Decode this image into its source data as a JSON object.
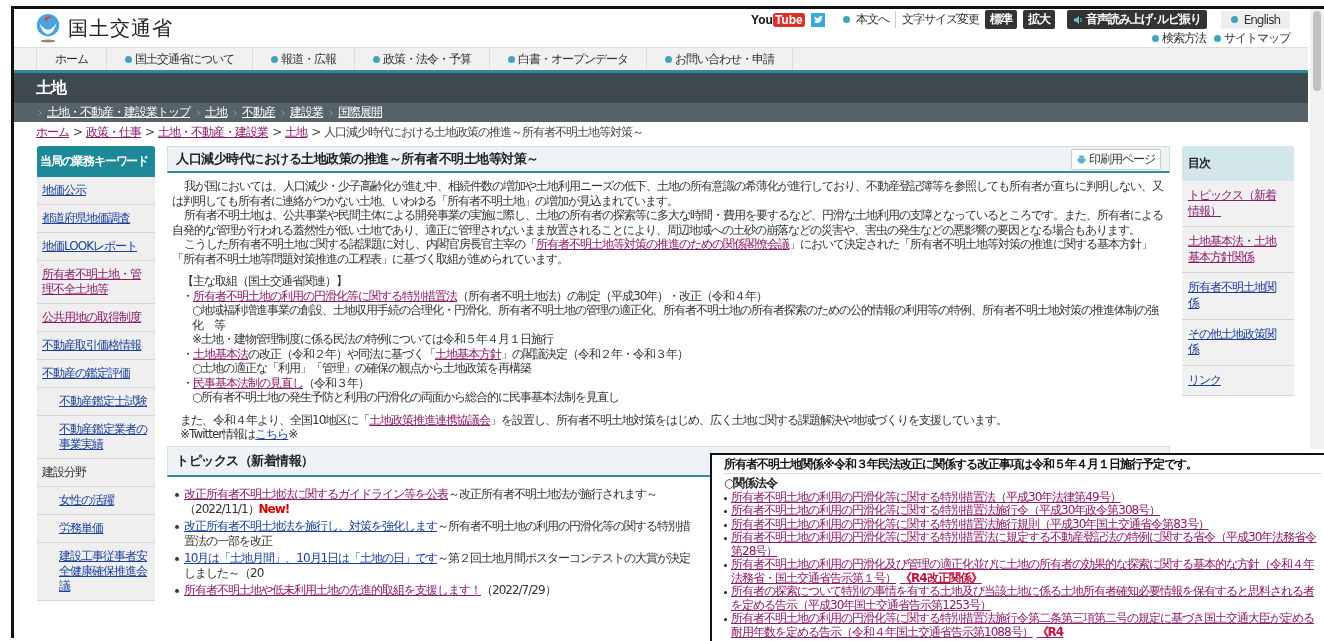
{
  "header": {
    "logo": "国土交通省",
    "youtube": [
      "You",
      "Tube"
    ],
    "tools": [
      {
        "kind": "link",
        "label": "本文へ"
      },
      {
        "kind": "label",
        "label": "文字サイズ変更"
      },
      {
        "kind": "size",
        "label": "標準"
      },
      {
        "kind": "size",
        "label": "拡大"
      },
      {
        "kind": "voice",
        "label": "音声読み上げ･ルビ振り"
      },
      {
        "kind": "lang",
        "label": "English"
      }
    ],
    "sublinks": [
      "検索方法",
      "サイトマップ"
    ]
  },
  "nav": [
    {
      "label": "ホーム",
      "dot": false
    },
    {
      "label": "国土交通省について",
      "dot": true
    },
    {
      "label": "報道・広報",
      "dot": true
    },
    {
      "label": "政策・法令・予算",
      "dot": true
    },
    {
      "label": "白書・オープンデータ",
      "dot": true
    },
    {
      "label": "お問い合わせ・申請",
      "dot": true
    }
  ],
  "section_title": "土地",
  "subnav": [
    "土地・不動産・建設業トップ",
    "土地",
    "不動産",
    "建設業",
    "国際展開"
  ],
  "breadcrumb": {
    "separator": ">",
    "items": [
      {
        "label": "ホーム",
        "kind": "link"
      },
      {
        "label": "政策・仕事",
        "kind": "link"
      },
      {
        "label": "土地・不動産・建設業",
        "kind": "link"
      },
      {
        "label": "土地",
        "kind": "link"
      },
      {
        "label": "人口減少時代における土地政策の推進～所有者不明土地等対策～",
        "kind": "current"
      }
    ]
  },
  "sidebar": {
    "title": "当局の業務キーワード",
    "items": [
      {
        "label": "地価公示",
        "kind": "link",
        "visited": false
      },
      {
        "label": "都道府県地価調査",
        "kind": "link",
        "visited": false
      },
      {
        "label": "地価LOOKレポート",
        "kind": "link",
        "visited": false
      },
      {
        "label": "所有者不明土地・管理不全土地等",
        "kind": "link",
        "visited": true
      },
      {
        "label": "公共用地の取得制度",
        "kind": "link",
        "visited": true
      },
      {
        "label": "不動産取引価格情報",
        "kind": "link",
        "visited": false
      },
      {
        "label": "不動産の鑑定評価",
        "kind": "link",
        "visited": false,
        "children": [
          {
            "label": "不動産鑑定士試験",
            "kind": "link",
            "visited": false
          },
          {
            "label": "不動産鑑定業者の事業実績",
            "kind": "link",
            "visited": false
          }
        ]
      },
      {
        "label": "建設分野",
        "kind": "heading",
        "children": [
          {
            "label": "女性の活躍",
            "kind": "link",
            "visited": false
          },
          {
            "label": "労務単価",
            "kind": "link",
            "visited": false
          },
          {
            "label": "建設工事従事者安全健康確保推進会議",
            "kind": "link",
            "visited": false
          }
        ]
      }
    ]
  },
  "article": {
    "title": "人口減少時代における土地政策の推進～所有者不明土地等対策～",
    "print_button": "印刷用ページ",
    "paragraphs": [
      [
        {
          "kind": "text",
          "text": "我が国においては、人口減少・少子高齢化が進む中、相続件数の増加や土地利用ニーズの低下、土地の所有意識の希薄化が進行しており、不動産登記簿等を参照しても所有者が直ちに判明しない、又は判明しても所有者に連絡がつかない土地、いわゆる「所有者不明土地」の増加が見込まれています。"
        }
      ],
      [
        {
          "kind": "text",
          "text": "所有者不明土地は、公共事業や民間主体による開発事業の実施に際し、土地の所有者の探索等に多大な時間・費用を要するなど、円滑な土地利用の支障となっているところです。また、所有者による自発的な管理が行われる蓋然性が低い土地であり、適正に管理されないまま放置されることにより、周辺地域への土砂の崩落などの災害や、害虫の発生などの悪影響の要因となる場合もあります。"
        }
      ],
      [
        {
          "kind": "text",
          "text": "こうした所有者不明土地に関する諸課題に対し、内閣官房長官主宰の「"
        },
        {
          "kind": "link",
          "text": "所有者不明土地等対策の推進のための関係閣僚会議",
          "visited": true
        },
        {
          "kind": "text",
          "text": "」において決定された「所有者不明土地等対策の推進に関する基本方針」「所有者不明土地等問題対策推進の工程表」に基づく取組が進められています。"
        }
      ]
    ],
    "efforts_heading": "【主な取組（国土交通省関連）】",
    "efforts": [
      {
        "kind": "bullet",
        "parts": [
          {
            "kind": "text",
            "text": "・"
          },
          {
            "kind": "link",
            "text": "所有者不明土地の利用の円滑化等に関する特別措置法",
            "visited": true
          },
          {
            "kind": "text",
            "text": "（所有者不明土地法）の制定（平成30年）・改正（令和４年）"
          }
        ]
      },
      {
        "kind": "sub",
        "parts": [
          {
            "kind": "text",
            "text": "○地域福利増進事業の創設、土地収用手続の合理化・円滑化、所有者不明土地の管理の適正化、所有者不明土地の所有者探索のための公的情報の利用等の特例、所有者不明土地対策の推進体制の強化　等"
          }
        ]
      },
      {
        "kind": "sub",
        "parts": [
          {
            "kind": "text",
            "text": "※土地・建物管理制度に係る民法の特例については令和５年４月１日施行"
          }
        ]
      },
      {
        "kind": "bullet",
        "parts": [
          {
            "kind": "text",
            "text": "・"
          },
          {
            "kind": "link",
            "text": "土地基本法",
            "visited": true
          },
          {
            "kind": "text",
            "text": "の改正（令和２年）や同法に基づく「"
          },
          {
            "kind": "link",
            "text": "土地基本方針",
            "visited": true
          },
          {
            "kind": "text",
            "text": "」の閣議決定（令和２年・令和３年）"
          }
        ]
      },
      {
        "kind": "sub",
        "parts": [
          {
            "kind": "text",
            "text": "○土地の適正な「利用」「管理」の確保の観点から土地政策を再構築"
          }
        ]
      },
      {
        "kind": "bullet",
        "parts": [
          {
            "kind": "text",
            "text": "・"
          },
          {
            "kind": "link",
            "text": "民事基本法制の見直し",
            "visited": true
          },
          {
            "kind": "text",
            "text": "（令和３年）"
          }
        ]
      },
      {
        "kind": "sub",
        "parts": [
          {
            "kind": "text",
            "text": "○所有者不明土地の発生予防と利用の円滑化の両面から総合的に民事基本法制を見直し"
          }
        ]
      }
    ],
    "closing": [
      [
        {
          "kind": "text",
          "text": "また、令和４年より、全国10地区に「"
        },
        {
          "kind": "link",
          "text": "土地政策推進連携協議会",
          "visited": true
        },
        {
          "kind": "text",
          "text": "」を設置し、所有者不明土地対策をはじめ、広く土地に関する課題解決や地域づくりを支援しています。"
        }
      ],
      [
        {
          "kind": "text",
          "text": "※Twitter情報は"
        },
        {
          "kind": "link",
          "text": "こちら",
          "visited": false
        },
        {
          "kind": "text",
          "text": "※"
        }
      ]
    ]
  },
  "topics": {
    "title": "トピックス（新着情報）",
    "items": [
      [
        {
          "kind": "link",
          "text": "改正所有者不明土地法に関するガイドライン等を公表",
          "visited": true
        },
        {
          "kind": "text",
          "text": "～改正所有者不明土地法が施行されます～（2022/11/1）"
        },
        {
          "kind": "new",
          "text": "New!"
        }
      ],
      [
        {
          "kind": "link",
          "text": "改正所有者不明土地法を施行し、対策を強化します",
          "visited": false
        },
        {
          "kind": "text",
          "text": "～所有者不明土地の利用の円滑化等の関する特別措置法の一部を改正"
        }
      ],
      [
        {
          "kind": "link",
          "text": "10月は「土地月間」、10月1日は「土地の日」です",
          "visited": false
        },
        {
          "kind": "text",
          "text": "～第２回土地月間ポスターコンテストの大賞が決定しました～（20"
        }
      ],
      [
        {
          "kind": "link",
          "text": "所有者不明土地や低未利用土地の先進的取組を支援します！",
          "visited": true
        },
        {
          "kind": "text",
          "text": "（2022/7/29）"
        }
      ]
    ]
  },
  "toc": {
    "title": "目次",
    "items": [
      {
        "label": "トピックス（新着情報）",
        "visited": true
      },
      {
        "label": "土地基本法・土地基本方針関係",
        "visited": true
      },
      {
        "label": "所有者不明土地関係",
        "visited": false
      },
      {
        "label": "その他土地政策関係",
        "visited": false
      },
      {
        "label": "リンク",
        "visited": false
      }
    ]
  },
  "inset": {
    "title": "所有者不明土地関係※令和３年民法改正に関係する改正事項は令和５年４月１日施行予定です。",
    "section": "○関係法令",
    "items": [
      {
        "kind": "bullet",
        "parts": [
          {
            "kind": "link",
            "text": "所有者不明土地の利用の円滑化等に関する特別措置法（平成30年法律第49号）",
            "visited": true
          }
        ]
      },
      {
        "kind": "bullet",
        "parts": [
          {
            "kind": "link",
            "text": "所有者不明土地の利用の円滑化等に関する特別措置法施行令（平成30年政令第308号）",
            "visited": true
          }
        ]
      },
      {
        "kind": "bullet",
        "parts": [
          {
            "kind": "link",
            "text": "所有者不明土地の利用の円滑化等に関する特別措置法施行規則（平成30年国土交通省令第83号）",
            "visited": true
          }
        ]
      },
      {
        "kind": "bullet",
        "parts": [
          {
            "kind": "link",
            "text": "所有者不明土地の利用の円滑化等に関する特別措置法に規定する不動産登記法の特例に関する省令（平成30年法務省令第28号）",
            "visited": true
          }
        ]
      },
      {
        "kind": "bullet",
        "parts": [
          {
            "kind": "link",
            "text": "所有者不明土地の利用の円滑化及び管理の適正化並びに土地の所有者の効果的な探索に関する基本的な方針（令和４年法務省・国土交通省告示第１号）",
            "visited": true
          },
          {
            "kind": "tag",
            "text": "《R4改正関係》"
          }
        ]
      },
      {
        "kind": "bullet",
        "parts": [
          {
            "kind": "link",
            "text": "所有者の探索について特別の事情を有する土地及び当該土地に係る土地所有者確知必要情報を保有すると思料される者を定める告示（平成30年国土交通省告示第1253号）",
            "visited": true
          }
        ]
      },
      {
        "kind": "bullet",
        "parts": [
          {
            "kind": "link",
            "text": "所有者不明土地の利用の円滑化等に関する特別措置法施行令第二条第三項第二号の規定に基づき国土交通大臣が定める耐用年数を定める告示（令和４年国土交通省告示第1088号）",
            "visited": true
          },
          {
            "kind": "tag",
            "text": "《R4"
          }
        ]
      }
    ]
  }
}
